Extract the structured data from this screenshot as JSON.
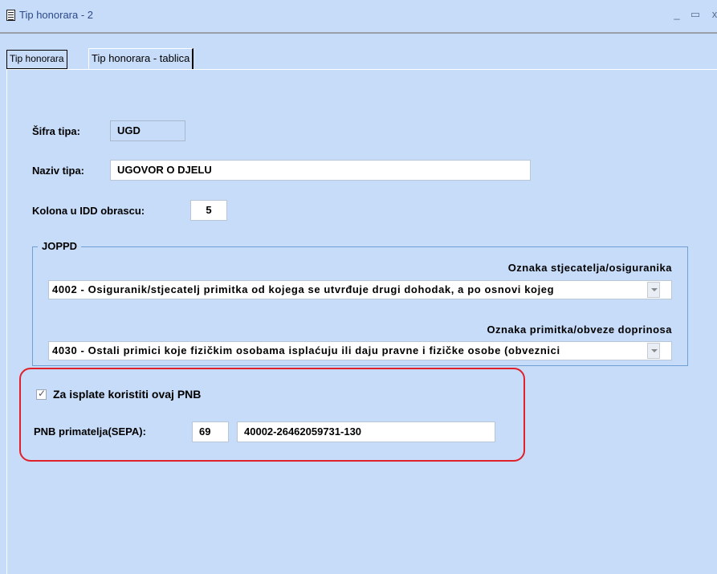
{
  "window": {
    "title": "Tip honorara - 2",
    "minimize_glyph": "_",
    "maximize_glyph": "▭",
    "close_glyph": "x"
  },
  "tabs": [
    {
      "label": "Tip honorara",
      "active": true
    },
    {
      "label": "Tip honorara - tablica",
      "active": false
    }
  ],
  "form": {
    "sifra_label": "Šifra tipa:",
    "sifra_value": "UGD",
    "naziv_label": "Naziv tipa:",
    "naziv_value": "UGOVOR O DJELU",
    "kolona_label": "Kolona u IDD obrascu:",
    "kolona_value": "5"
  },
  "joppd": {
    "group_title": "JOPPD",
    "stjecatelj_label": "Oznaka stjecatelja/osiguranika",
    "stjecatelj_value": "4002 - Osiguranik/stjecatelj primitka od kojega se utvrđuje drugi dohodak, a po osnovi kojeg",
    "primitak_label": "Oznaka primitka/obveze doprinosa",
    "primitak_value": "4030 - Ostali primici koje fizičkim osobama isplaćuju ili daju pravne i fizičke osobe (obveznici"
  },
  "pnb": {
    "checkbox_label": "Za isplate koristiti ovaj PNB",
    "checked": true,
    "label": "PNB primatelja(SEPA):",
    "model": "69",
    "number": "40002-26462059731-130"
  },
  "colors": {
    "background": "#c7dcf9",
    "highlight_border": "#e0202a",
    "group_border": "#6f9fd4"
  },
  "icons": [
    "window-menu-icon",
    "chevron-down-icon",
    "check-icon"
  ]
}
